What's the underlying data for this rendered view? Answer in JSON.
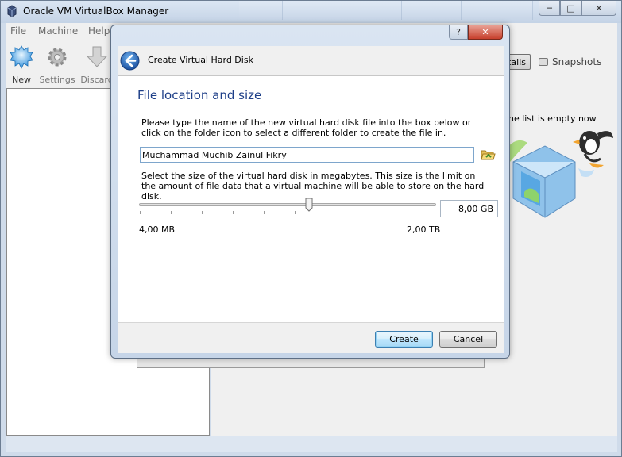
{
  "window": {
    "title": "Oracle VM VirtualBox Manager",
    "min": "─",
    "max": "□",
    "close": "✕"
  },
  "menu": [
    "File",
    "Machine",
    "Help"
  ],
  "toolbar": {
    "new": "New",
    "settings": "Settings",
    "discard": "Discard"
  },
  "right": {
    "details_tab": "tails",
    "snapshots_tab": "Snapshots",
    "empty_text": "he list is empty now"
  },
  "dialog": {
    "help": "?",
    "close": "✕",
    "title": "Create Virtual Hard Disk",
    "section_title": "File location and size",
    "instructions": "Please type the name of the new virtual hard disk file into the box below or click on the folder icon to select a different folder to create the file in.",
    "file_name": "Muchammad Muchib Zainul Fikry",
    "size_instructions": "Select the size of the virtual hard disk in megabytes. This size is the limit on the amount of file data that a virtual machine will be able to store on the hard disk.",
    "slider_fraction": 0.575,
    "size_value": "8,00 GB",
    "min_label": "4,00 MB",
    "max_label": "2,00 TB",
    "create_button": "Create",
    "cancel_button": "Cancel"
  }
}
